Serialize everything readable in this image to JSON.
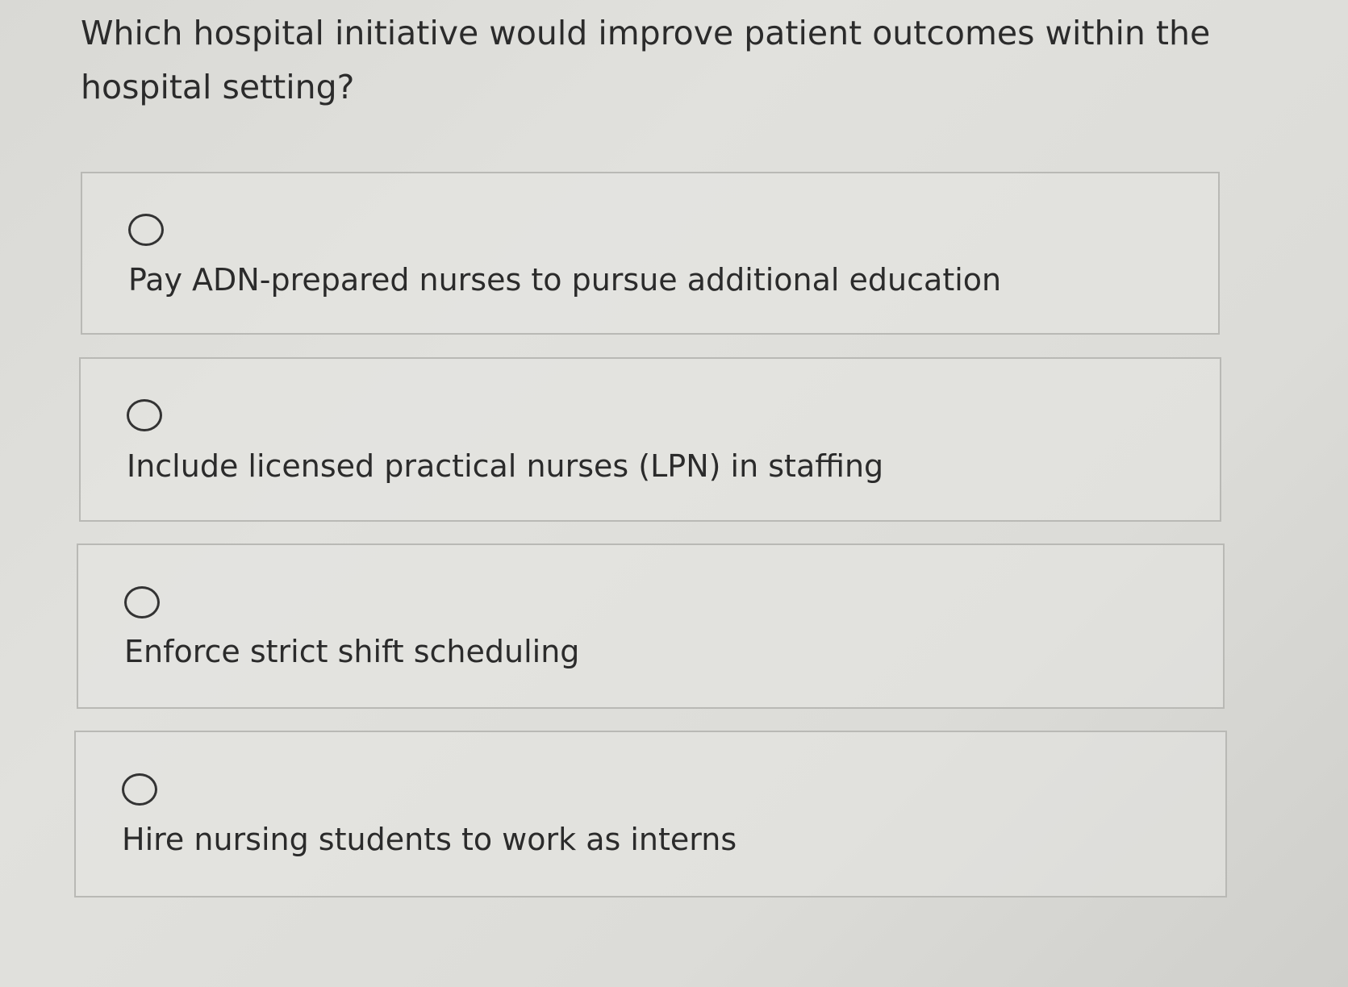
{
  "question": {
    "text": "Which hospital initiative would improve patient outcomes within the hospital setting?"
  },
  "options": [
    {
      "label": "Pay ADN-prepared nurses to pursue additional education",
      "selected": false
    },
    {
      "label": "Include licensed practical nurses (LPN) in staffing",
      "selected": false
    },
    {
      "label": "Enforce strict shift scheduling",
      "selected": false
    },
    {
      "label": "Hire nursing students to work as interns",
      "selected": false
    }
  ]
}
